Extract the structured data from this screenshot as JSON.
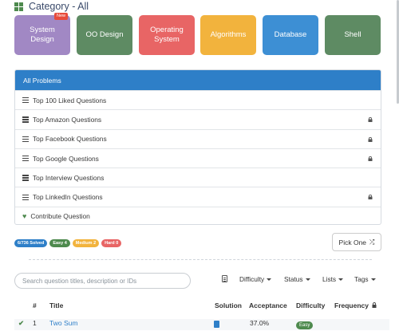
{
  "header": {
    "title": "Category - All"
  },
  "categories": [
    {
      "label": "System\nDesign",
      "color": "#a188c4",
      "badge": "New"
    },
    {
      "label": "OO Design",
      "color": "#5e8b63"
    },
    {
      "label": "Operating\nSystem",
      "color": "#e86565"
    },
    {
      "label": "Algorithms",
      "color": "#f2b33d"
    },
    {
      "label": "Database",
      "color": "#3d8fd4"
    },
    {
      "label": "Shell",
      "color": "#5e8b63"
    }
  ],
  "problems_panel": {
    "heading": "All Problems",
    "items": [
      {
        "label": "Top 100 Liked Questions",
        "locked": false
      },
      {
        "label": "Top Amazon Questions",
        "locked": true
      },
      {
        "label": "Top Facebook Questions",
        "locked": true
      },
      {
        "label": "Top Google Questions",
        "locked": true
      },
      {
        "label": "Top Interview Questions",
        "locked": false
      },
      {
        "label": "Top LinkedIn Questions",
        "locked": true
      }
    ],
    "contribute_label": "Contribute Question"
  },
  "stats": {
    "solved": "6/736 Solved",
    "easy": "Easy 4",
    "medium": "Medium 2",
    "hard": "Hard 0",
    "colors": {
      "solved": "#2e7fc8",
      "easy": "#4e8a4e",
      "medium": "#f2b33d",
      "hard": "#e86565"
    }
  },
  "pick_one": {
    "label": "Pick One",
    "icon": "shuffle-icon"
  },
  "search": {
    "placeholder": "Search question titles, description or IDs",
    "value": ""
  },
  "filters": {
    "difficulty": "Difficulty",
    "status": "Status",
    "lists": "Lists",
    "tags": "Tags"
  },
  "table": {
    "headers": {
      "num": "#",
      "title": "Title",
      "solution": "Solution",
      "acceptance": "Acceptance",
      "difficulty": "Difficulty",
      "frequency": "Frequency"
    },
    "rows": [
      {
        "id": "1",
        "title": "Two Sum",
        "acceptance": "37.0%",
        "difficulty": "Easy"
      }
    ]
  }
}
